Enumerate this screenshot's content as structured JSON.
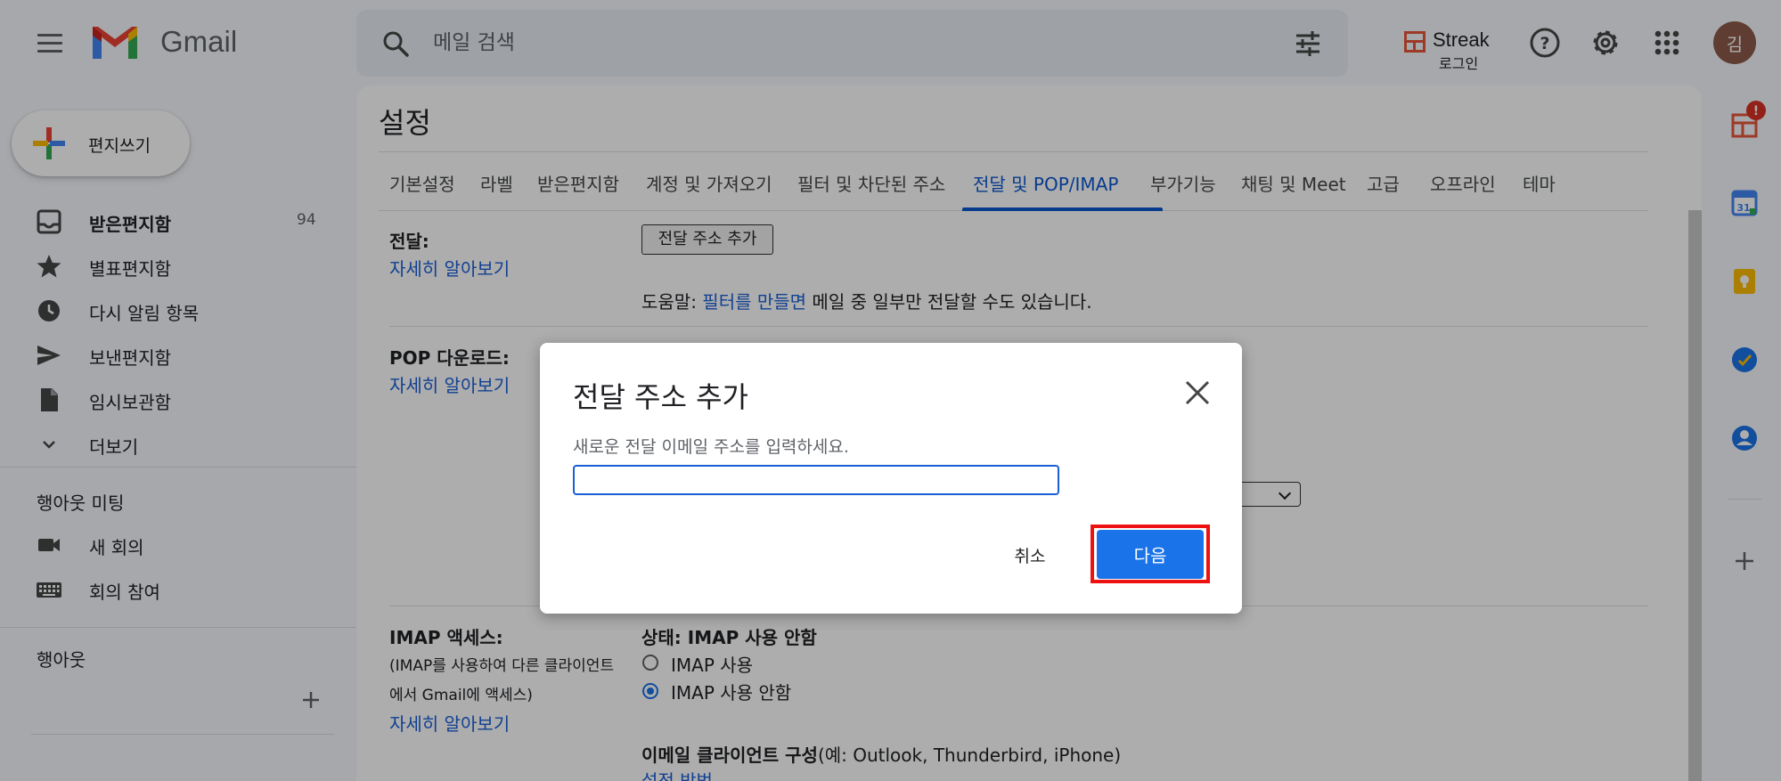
{
  "header": {
    "app_name": "Gmail",
    "search_placeholder": "메일 검색",
    "streak_name": "Streak",
    "streak_sub": "로그인",
    "avatar_initial": "김"
  },
  "sidebar": {
    "compose_label": "편지쓰기",
    "items": [
      {
        "label": "받은편지함",
        "count": "94",
        "icon": "inbox-icon"
      },
      {
        "label": "별표편지함",
        "icon": "star-icon"
      },
      {
        "label": "다시 알림 항목",
        "icon": "clock-icon"
      },
      {
        "label": "보낸편지함",
        "icon": "send-icon"
      },
      {
        "label": "임시보관함",
        "icon": "draft-icon"
      },
      {
        "label": "더보기",
        "icon": "chevron-down-icon"
      }
    ],
    "meet_title": "행아웃 미팅",
    "meet_items": [
      {
        "label": "새 회의",
        "icon": "video-icon"
      },
      {
        "label": "회의 참여",
        "icon": "keyboard-icon"
      }
    ],
    "hangouts_title": "행아웃"
  },
  "settings": {
    "title": "설정",
    "tabs": [
      "기본설정",
      "라벨",
      "받은편지함",
      "계정 및 가져오기",
      "필터 및 차단된 주소",
      "전달 및 POP/IMAP",
      "부가기능",
      "채팅 및 Meet",
      "고급",
      "오프라인",
      "테마"
    ],
    "active_tab": "전달 및 POP/IMAP",
    "forwarding_label": "전달:",
    "learn_more": "자세히 알아보기",
    "add_forward_button": "전달 주소 추가",
    "tip_prefix": "도움말: ",
    "tip_link": "필터를 만들면",
    "tip_suffix": " 메일 중 일부만 전달할 수도 있습니다.",
    "pop_label": "POP 다운로드:",
    "imap_label": "IMAP 액세스:",
    "imap_desc_line1": "(IMAP를 사용하여 다른 클라이언트",
    "imap_desc_line2": "에서 Gmail에 액세스)",
    "imap_status": "상태: IMAP 사용 안함",
    "imap_enable": "IMAP 사용",
    "imap_disable": "IMAP 사용 안함",
    "imap_selected": "IMAP 사용 안함",
    "client_config_bold": "이메일 클라이언트 구성",
    "client_config_rest": "(예: Outlook, Thunderbird, iPhone)",
    "setup_link": "설정 방법"
  },
  "dialog": {
    "title": "전달 주소 추가",
    "description": "새로운 전달 이메일 주소를 입력하세요.",
    "input_value": "",
    "cancel": "취소",
    "next": "다음"
  },
  "colors": {
    "accent": "#1a73e8",
    "link": "#1a5fd6",
    "highlight_frame": "#ee1111",
    "notification": "#d93025"
  }
}
